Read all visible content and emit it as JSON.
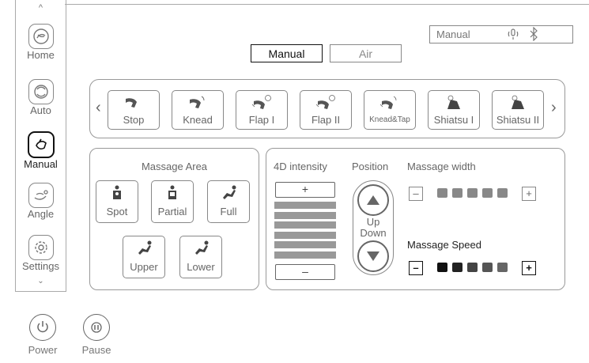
{
  "sidebar": {
    "items": [
      {
        "label": "Home",
        "icon": "home-icon"
      },
      {
        "label": "Auto",
        "icon": "auto-icon"
      },
      {
        "label": "Manual",
        "icon": "manual-icon",
        "active": true
      },
      {
        "label": "Angle",
        "icon": "angle-icon"
      },
      {
        "label": "Settings",
        "icon": "settings-icon"
      }
    ]
  },
  "status": {
    "mode": "Manual",
    "icons": [
      "voice-icon",
      "bluetooth-icon"
    ]
  },
  "mode_tabs": [
    {
      "label": "Manual",
      "active": true
    },
    {
      "label": "Air",
      "active": false
    }
  ],
  "programs": [
    {
      "label": "Stop"
    },
    {
      "label": "Knead"
    },
    {
      "label": "Flap I"
    },
    {
      "label": "Flap II"
    },
    {
      "label": "Knead&Tap"
    },
    {
      "label": "Shiatsu I"
    },
    {
      "label": "Shiatsu II"
    }
  ],
  "massage_area": {
    "title": "Massage Area",
    "options": [
      "Spot",
      "Partial",
      "Full",
      "Upper",
      "Lower"
    ]
  },
  "intensity": {
    "title": "4D intensity",
    "plus": "+",
    "minus": "–",
    "level": 6,
    "max": 6
  },
  "position": {
    "title": "Position",
    "up_label": "Up",
    "down_label": "Down"
  },
  "width": {
    "title": "Massage width",
    "minus": "–",
    "plus": "+",
    "level": 5,
    "max": 5,
    "color": "#888888"
  },
  "speed": {
    "title": "Massage Speed",
    "minus": "–",
    "plus": "+",
    "colors": [
      "#111111",
      "#222222",
      "#444444",
      "#555555",
      "#666666"
    ]
  },
  "bottom": {
    "power_label": "Power",
    "pause_label": "Pause"
  }
}
